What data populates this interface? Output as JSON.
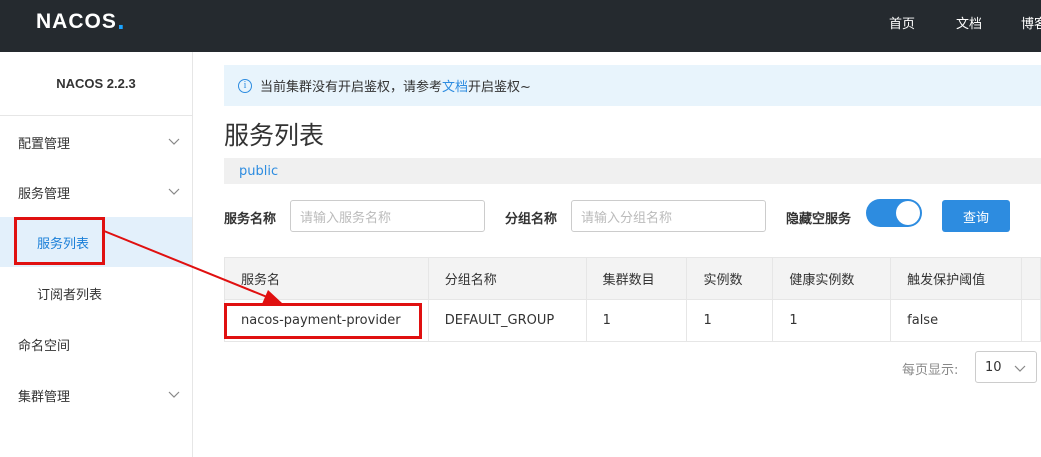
{
  "app": {
    "logo_text": "NACOS",
    "logo_dot": "."
  },
  "topnav": {
    "items": [
      "首页",
      "文档",
      "博客"
    ]
  },
  "sidebar": {
    "version": "NACOS 2.2.3",
    "items": [
      {
        "label": "配置管理"
      },
      {
        "label": "服务管理"
      },
      {
        "label": "服务列表"
      },
      {
        "label": "订阅者列表"
      },
      {
        "label": "命名空间"
      },
      {
        "label": "集群管理"
      }
    ]
  },
  "notice": {
    "prefix": "当前集群没有开启鉴权，请参考",
    "link": "文档",
    "suffix": "开启鉴权~"
  },
  "page": {
    "title": "服务列表",
    "namespace": "public"
  },
  "filters": {
    "service_name_label": "服务名称",
    "service_name_placeholder": "请输入服务名称",
    "group_name_label": "分组名称",
    "group_name_placeholder": "请输入分组名称",
    "hide_empty_label": "隐藏空服务",
    "hide_empty_on": true,
    "query_button": "查询"
  },
  "table": {
    "headers": [
      "服务名",
      "分组名称",
      "集群数目",
      "实例数",
      "健康实例数",
      "触发保护阈值",
      ""
    ],
    "rows": [
      [
        "nacos-payment-provider",
        "DEFAULT_GROUP",
        "1",
        "1",
        "1",
        "false",
        ""
      ]
    ]
  },
  "pagination": {
    "label": "每页显示:",
    "page_size": "10"
  },
  "colors": {
    "accent": "#2d8ce0",
    "topbar": "#252a2f",
    "annotation": "#e01010"
  }
}
